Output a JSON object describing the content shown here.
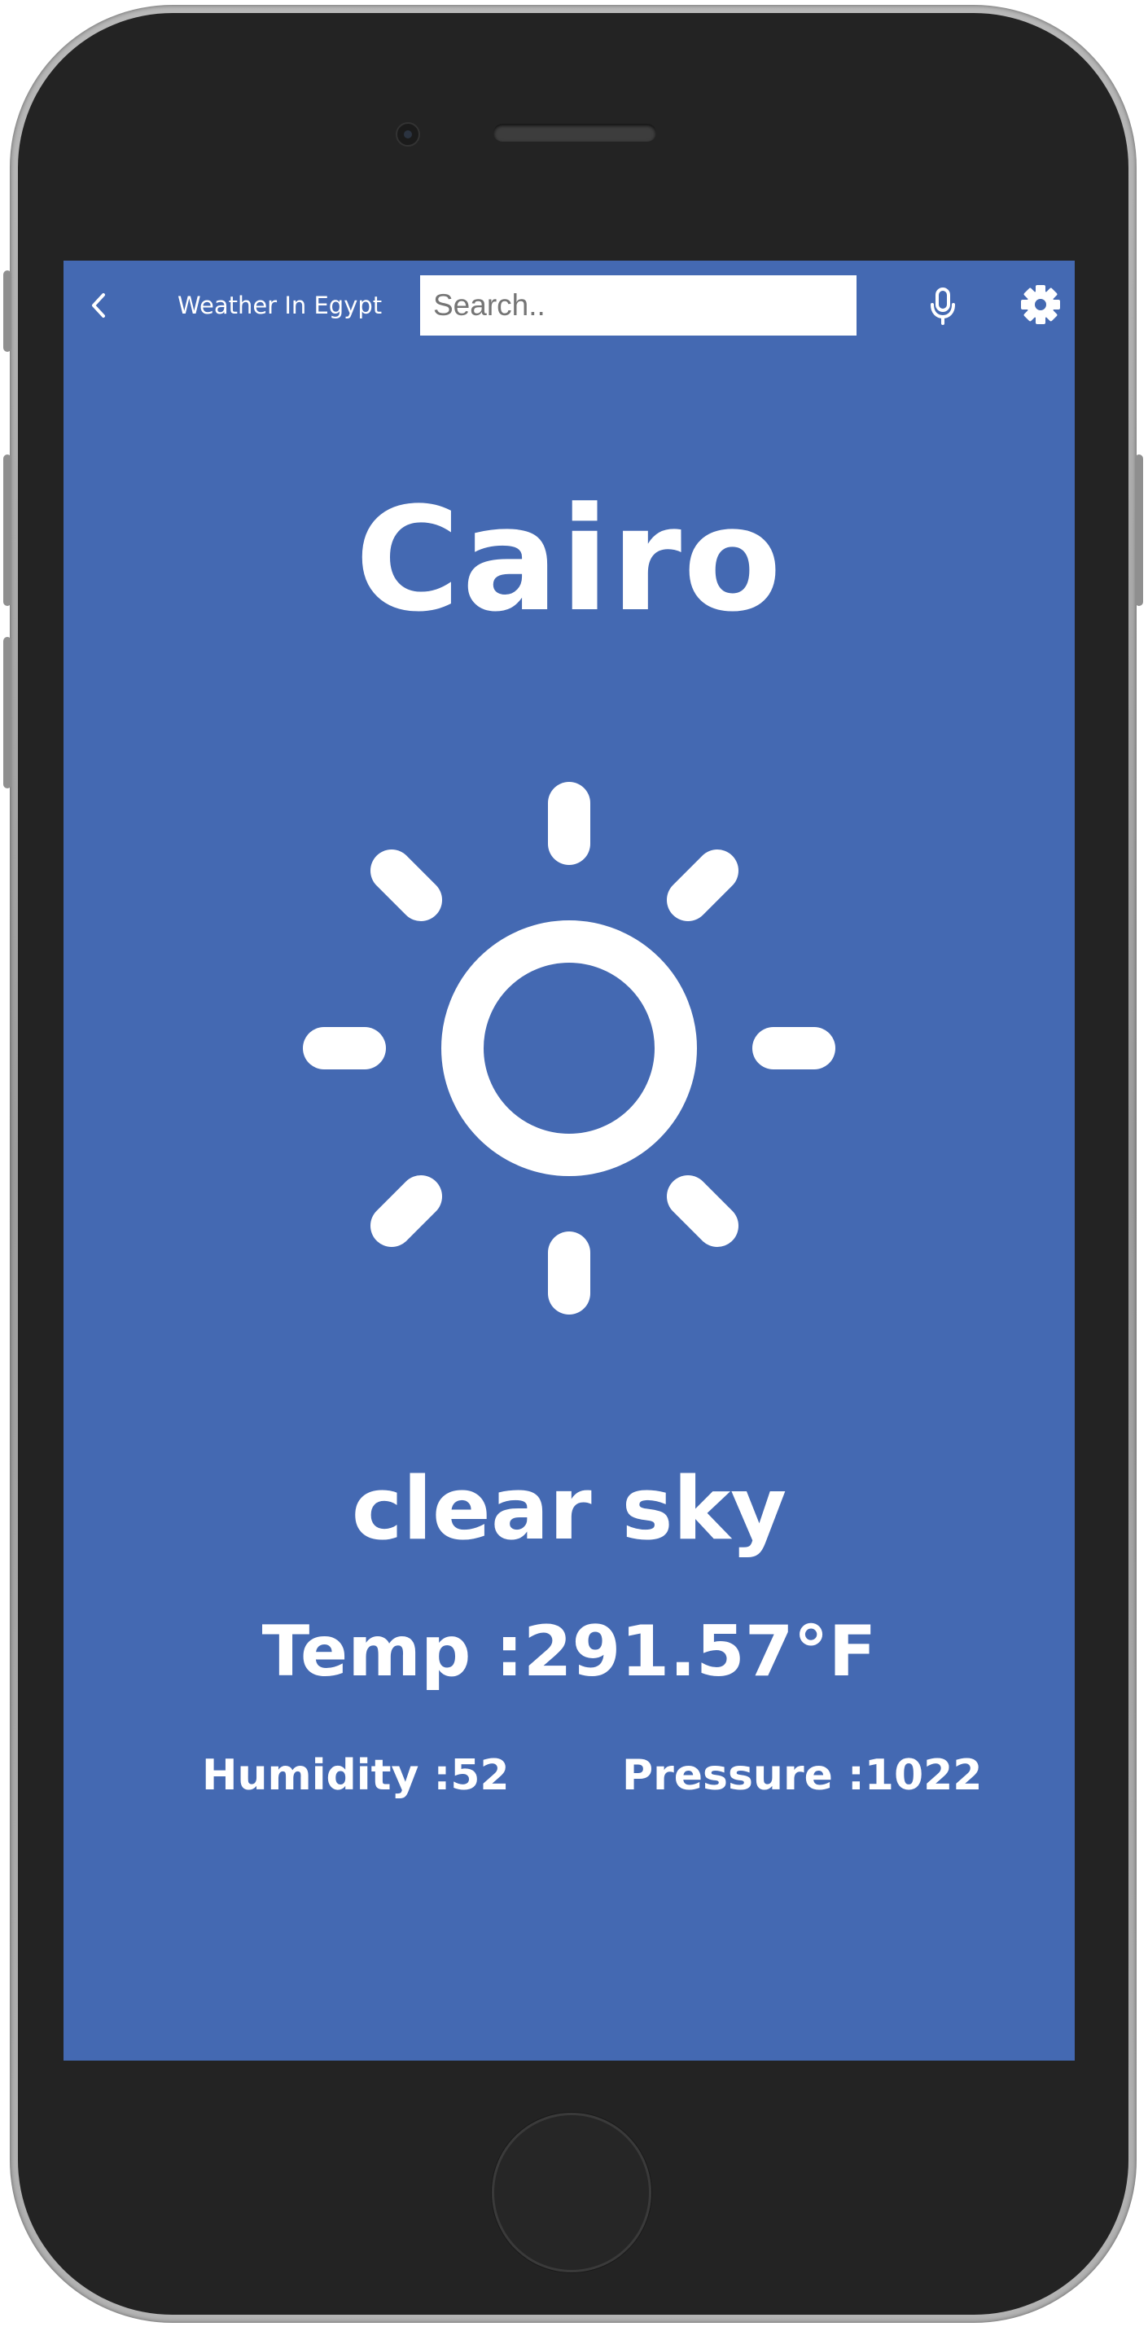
{
  "header": {
    "back_icon": "chevron-left-icon",
    "title": "Weather In Egypt",
    "search_placeholder": "Search..",
    "search_value": "",
    "mic_icon": "microphone-icon",
    "settings_icon": "gear-icon"
  },
  "weather": {
    "city": "Cairo",
    "condition_icon": "sun-icon",
    "description": "clear sky",
    "temp_label": "Temp :",
    "temp_value": "291.57",
    "temp_unit": "°F",
    "humidity_label": "Humidity :",
    "humidity_value": "52",
    "pressure_label": "Pressure :",
    "pressure_value": "1022"
  },
  "colors": {
    "screen_background": "#4469b2",
    "foreground": "#ffffff",
    "device_body": "#232323"
  }
}
